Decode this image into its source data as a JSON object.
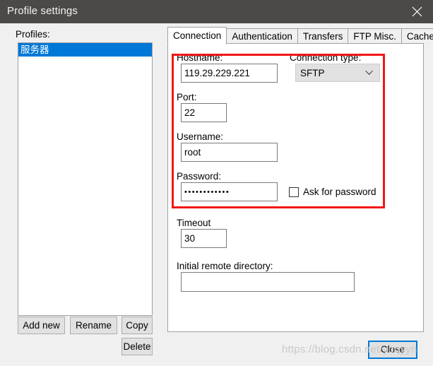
{
  "window": {
    "title": "Profile settings",
    "close_icon": "close-x-icon",
    "titlebar_color": "#4c4a48",
    "background_color": "#f0f0f0"
  },
  "left_panel": {
    "profiles_label": "Profiles:",
    "profiles": [
      {
        "name": "服务器",
        "selected": true
      }
    ],
    "selection_color": "#0078d7",
    "buttons": {
      "add_new": "Add new",
      "rename": "Rename",
      "copy": "Copy",
      "delete": "Delete"
    }
  },
  "tabs": [
    {
      "label": "Connection",
      "active": true
    },
    {
      "label": "Authentication",
      "active": false
    },
    {
      "label": "Transfers",
      "active": false
    },
    {
      "label": "FTP Misc.",
      "active": false
    },
    {
      "label": "Cache",
      "active": false
    }
  ],
  "connection_tab": {
    "hostname": {
      "label": "Hostname:",
      "value": "119.29.229.221",
      "placeholder": ""
    },
    "connection_type": {
      "label": "Connection type:",
      "value": "SFTP",
      "chevron_icon": "chevron-down-icon"
    },
    "port": {
      "label": "Port:",
      "value": "22",
      "placeholder": ""
    },
    "username": {
      "label": "Username:",
      "value": "root",
      "placeholder": ""
    },
    "password": {
      "label": "Password:",
      "value": "••••••••••••",
      "placeholder": ""
    },
    "ask_for_password": {
      "label": "Ask for password",
      "checked": false
    },
    "timeout": {
      "label": "Timeout",
      "value": "30",
      "placeholder": ""
    },
    "initial_remote_directory": {
      "label": "Initial remote directory:",
      "value": "",
      "placeholder": ""
    }
  },
  "footer": {
    "close_button": "Close",
    "focus_color": "#0078d7"
  },
  "overlay": {
    "annotation_color": "#f41616",
    "watermark": "https://blog.csdn.net/ybqyyn"
  }
}
